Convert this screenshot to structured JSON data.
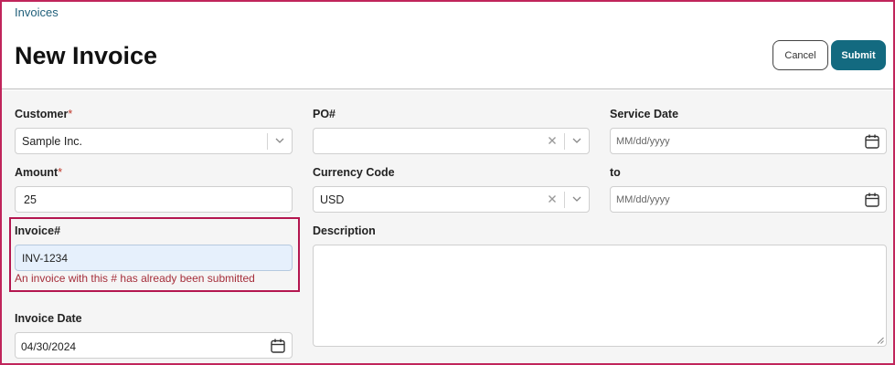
{
  "header": {
    "breadcrumb": "Invoices",
    "title": "New Invoice",
    "cancel_label": "Cancel",
    "submit_label": "Submit"
  },
  "form": {
    "customer": {
      "label": "Customer",
      "required_mark": "*",
      "value": "Sample Inc."
    },
    "po": {
      "label": "PO#",
      "value": ""
    },
    "service_date": {
      "label": "Service Date",
      "placeholder": "MM/dd/yyyy"
    },
    "amount": {
      "label": "Amount",
      "required_mark": "*",
      "value": "25"
    },
    "currency": {
      "label": "Currency Code",
      "value": "USD"
    },
    "to": {
      "label": "to",
      "placeholder": "MM/dd/yyyy"
    },
    "invoice_number": {
      "label": "Invoice#",
      "value": "INV-1234",
      "error": "An invoice with this # has already been submitted"
    },
    "description": {
      "label": "Description",
      "value": ""
    },
    "invoice_date": {
      "label": "Invoice Date",
      "value": "04/30/2024"
    }
  },
  "colors": {
    "accent": "#136a80",
    "error": "#a52e3a",
    "highlight": "#b4164f",
    "frame": "#c0255b"
  }
}
